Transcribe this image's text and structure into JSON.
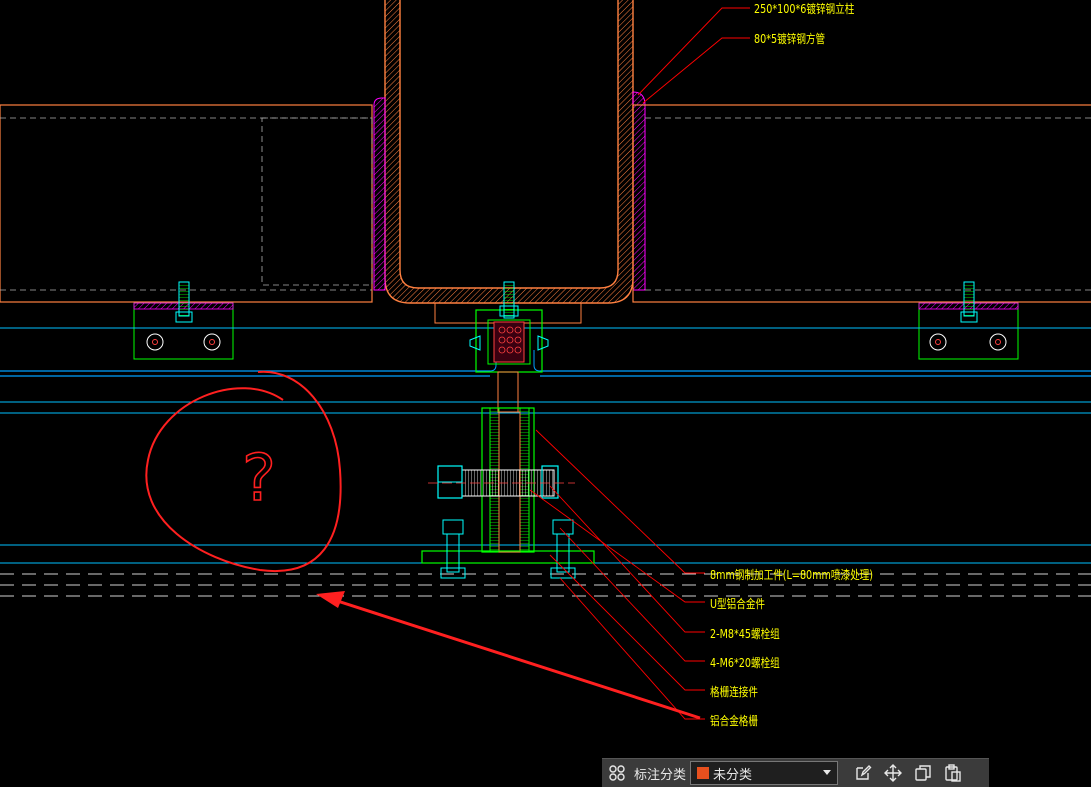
{
  "annotations": [
    {
      "id": "a1",
      "text": "250*100*6镀锌钢立柱"
    },
    {
      "id": "a2",
      "text": "80*5镀锌钢方管"
    },
    {
      "id": "a3",
      "text": "8mm钢制加工件(L=80mm喷漆处理)"
    },
    {
      "id": "a4",
      "text": "U型铝合金件"
    },
    {
      "id": "a5",
      "text": "2-M8*45螺栓组"
    },
    {
      "id": "a6",
      "text": "4-M6*20螺栓组"
    },
    {
      "id": "a7",
      "text": "格栅连接件"
    },
    {
      "id": "a8",
      "text": "铝合金格栅"
    }
  ],
  "markup": {
    "question_mark": "?"
  },
  "toolbar": {
    "label": "标注分类",
    "category_value": "未分类",
    "category_color": "#e8501e",
    "icons": [
      "grid-icon",
      "edit-icon",
      "move-icon",
      "copy-icon",
      "paste-icon"
    ]
  },
  "colors": {
    "background": "#000000",
    "annotation_text": "#ffff00",
    "leader": "#ff0000",
    "steel": "#ff8040",
    "bolt": "#00ffff",
    "bracket": "#00ff00",
    "weld": "#ff00ff",
    "grating": "#00c0ff",
    "markup": "#ff2020"
  }
}
